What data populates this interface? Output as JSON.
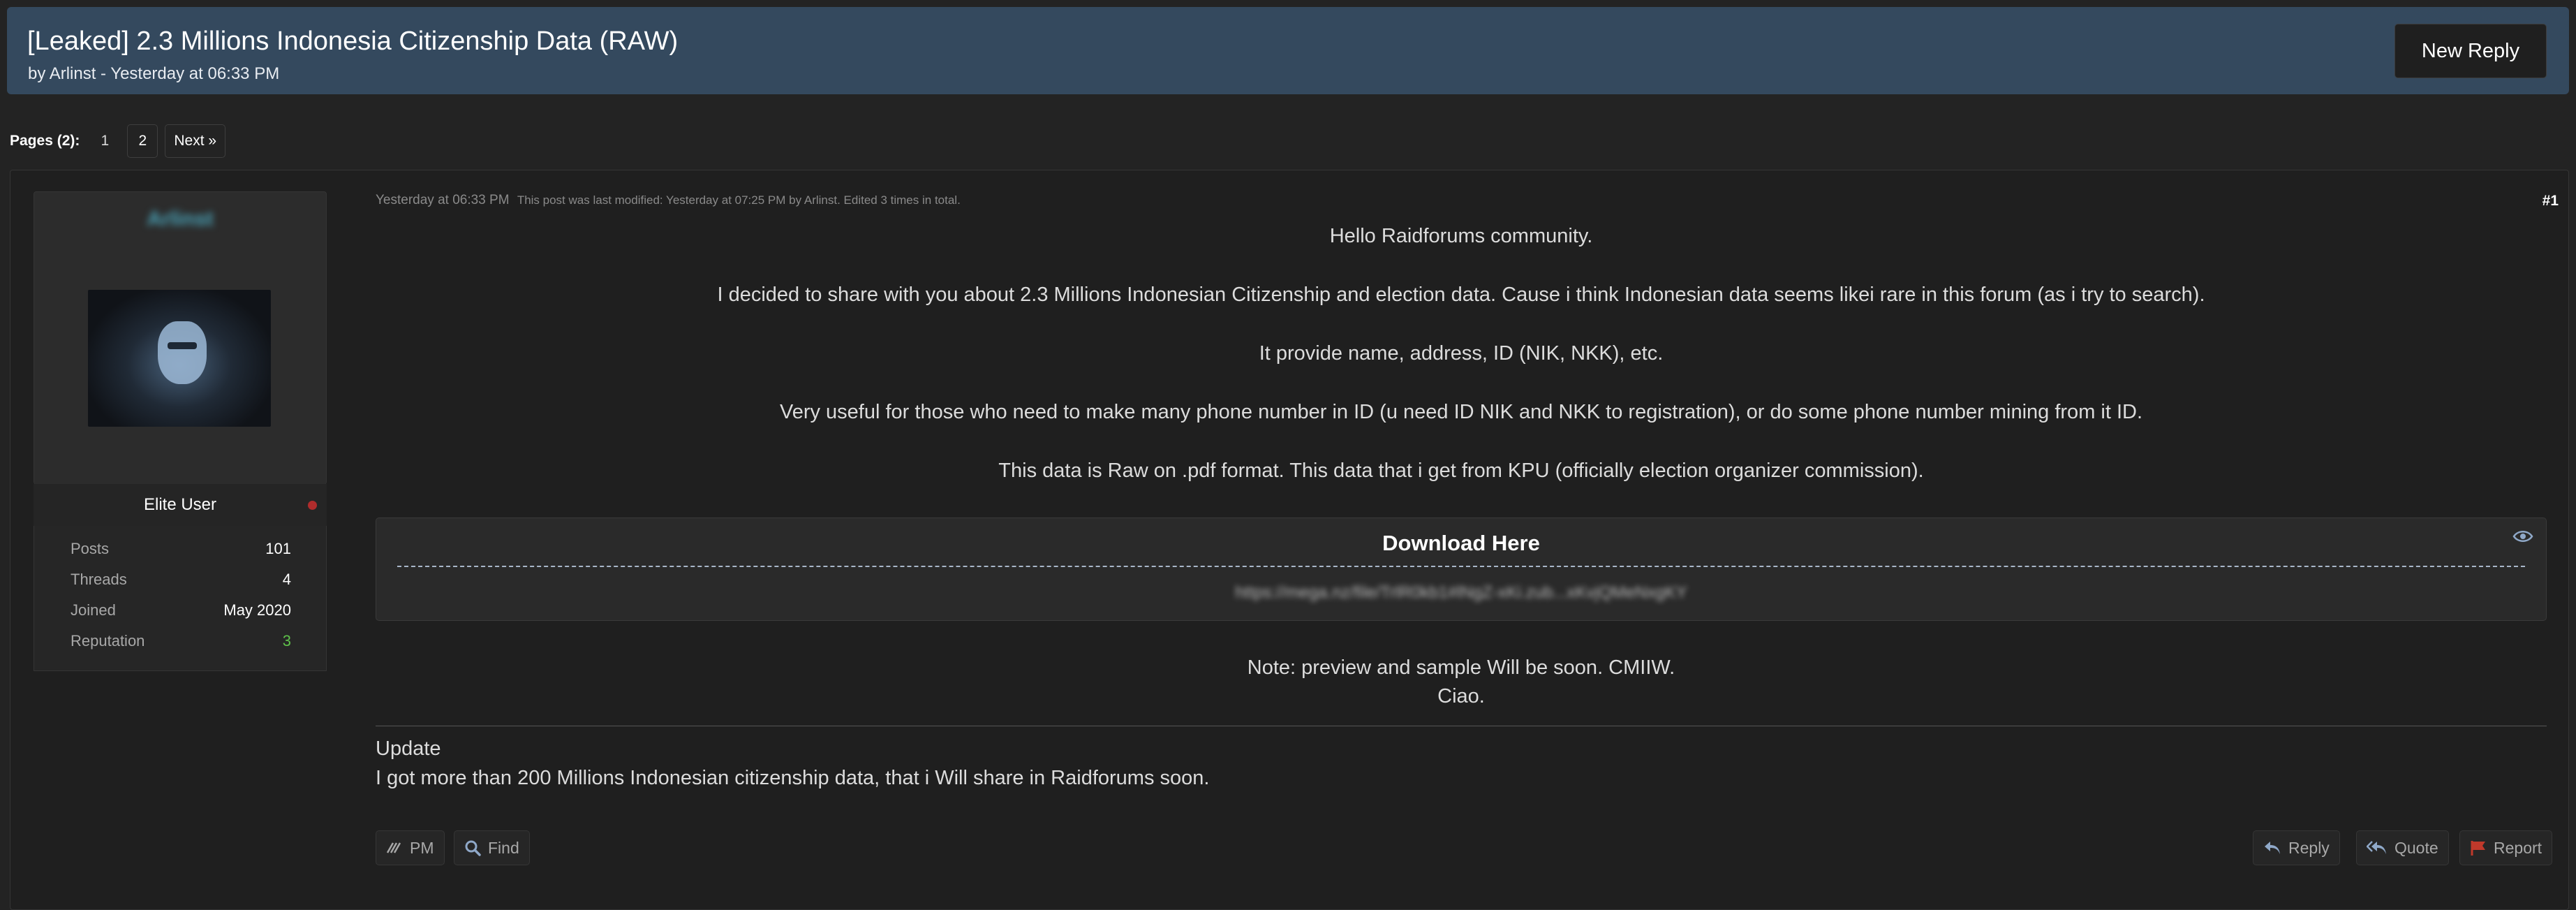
{
  "thread": {
    "title": "[Leaked] 2.3 Millions Indonesia Citizenship Data (RAW)",
    "byline": "by Arlinst - Yesterday at 06:33 PM",
    "new_reply_label": "New Reply"
  },
  "pagination": {
    "label": "Pages (2):",
    "pages": [
      "1",
      "2"
    ],
    "next_label": "Next »"
  },
  "user": {
    "username": "Arlinst",
    "rank": "Elite User",
    "stats": [
      {
        "label": "Posts",
        "value": "101"
      },
      {
        "label": "Threads",
        "value": "4"
      },
      {
        "label": "Joined",
        "value": "May 2020"
      },
      {
        "label": "Reputation",
        "value": "3"
      }
    ],
    "status_color": "#b02c2c"
  },
  "post": {
    "date": "Yesterday at 06:33 PM",
    "edit_note": "This post was last modified: Yesterday at 07:25 PM by Arlinst. Edited 3 times in total.",
    "number": "#1",
    "lines": [
      "Hello Raidforums community.",
      "I decided to share with you about 2.3 Millions Indonesian Citizenship and election data. Cause i think Indonesian data seems likei rare in this forum (as i try to search).",
      "It provide name, address, ID (NIK, NKK), etc.",
      "Very useful for those who need to make many phone number in ID (u need ID NIK and NKK to registration), or do some phone number mining from it ID.",
      "This data is Raw on .pdf format. This data that i get from KPU (officially election organizer commission)."
    ],
    "hidden_content": {
      "title": "Download Here",
      "link": "https://mega.nz/file/TrlR0kb1#lNgZ-xKi.zub...xKvjQMeNxgKY"
    },
    "note_lines": [
      "Note: preview and sample Will be soon. CMIIW.",
      "Ciao."
    ],
    "update_heading": "Update",
    "update_text": "I got more than 200 Millions Indonesian citizenship data, that i Will share in Raidforums soon."
  },
  "actions": {
    "pm": "PM",
    "find": "Find",
    "reply": "Reply",
    "quote": "Quote",
    "report": "Report"
  },
  "colors": {
    "header_bg": "#34495e",
    "reputation": "#5ec24a",
    "report_flag": "#c0392b",
    "reply_icon": "#8fa8c8"
  }
}
